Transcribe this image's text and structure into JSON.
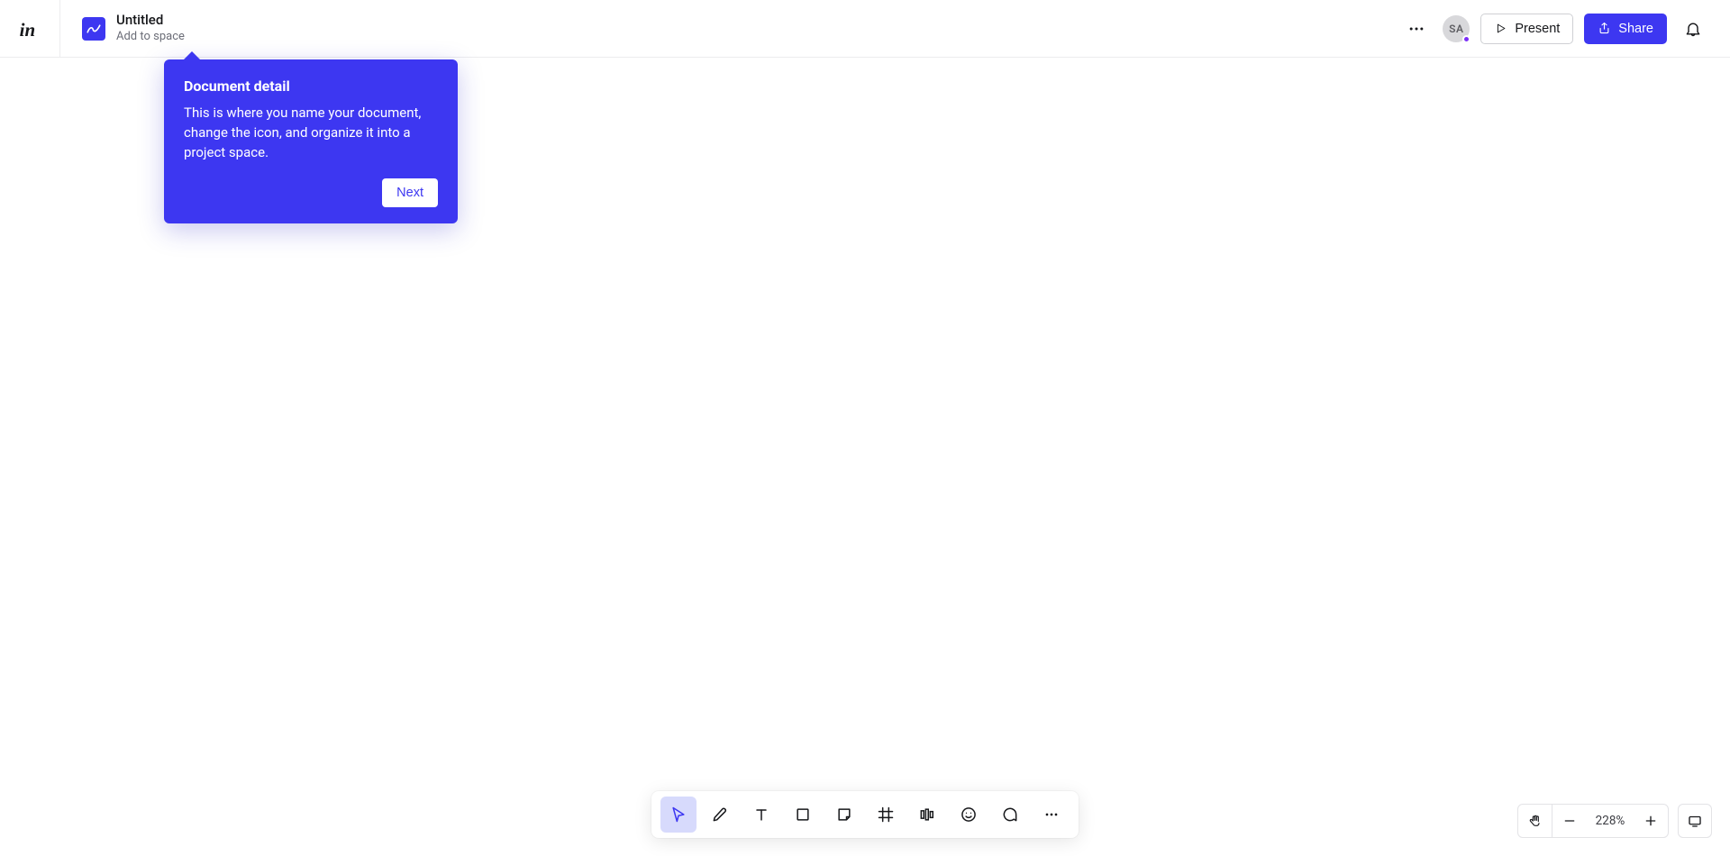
{
  "header": {
    "doc_title": "Untitled",
    "doc_subtitle": "Add to space",
    "avatar_initials": "SA",
    "present_label": "Present",
    "share_label": "Share"
  },
  "tooltip": {
    "title": "Document detail",
    "body": "This is where you name your document, change the icon, and organize it into a project space.",
    "next_label": "Next"
  },
  "tools": {
    "select": "Select",
    "draw": "Draw",
    "text": "Text",
    "shape": "Shape",
    "sticky": "Sticky note",
    "frame": "Frame",
    "align": "Align",
    "emoji": "Emoji",
    "comment": "Comment",
    "more": "More"
  },
  "zoom": {
    "value": "228%"
  }
}
